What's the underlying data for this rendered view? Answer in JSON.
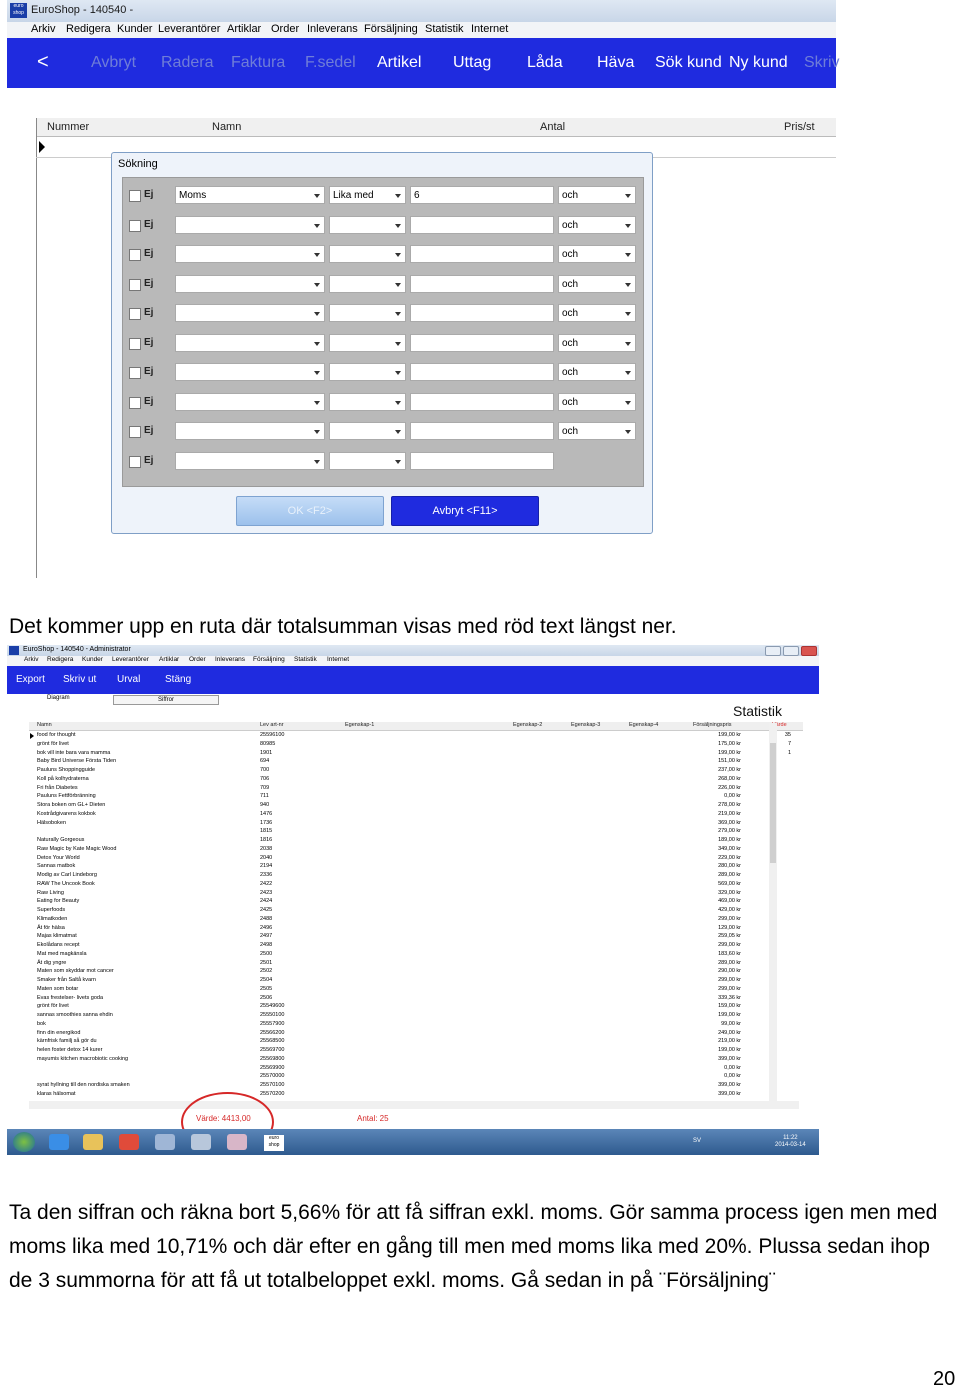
{
  "shot1": {
    "title": "EuroShop - 140540 -",
    "logo_text": "euro shop",
    "menu": [
      "Arkiv",
      "Redigera",
      "Kunder",
      "Leverantörer",
      "Artiklar",
      "Order",
      "Inleverans",
      "Försäljning",
      "Statistik",
      "Internet"
    ],
    "toolbar": {
      "back": "<",
      "items": [
        "Avbryt",
        "Radera",
        "Faktura",
        "F.sedel",
        "Artikel",
        "Uttag",
        "Låda",
        "Häva",
        "Sök kund",
        "Ny kund",
        "Skriv"
      ]
    },
    "grid_headers": {
      "col1": "Nummer",
      "col2": "Namn",
      "col3": "Antal",
      "col4": "Pris/st"
    },
    "dialog": {
      "title": "Sökning",
      "ej_label": "Ej",
      "first_field": "Moms",
      "first_op": "Lika med",
      "first_value": "6",
      "connector": "och",
      "ok_label": "OK <F2>",
      "cancel_label": "Avbryt <F11>"
    }
  },
  "text": {
    "para1": "Det kommer upp en ruta där totalsumman visas med röd text längst ner.",
    "para2": "Ta den siffran och räkna bort 5,66% för att få siffran exkl. moms. Gör samma process igen men med moms lika med 10,71% och där efter en gång till men med moms lika med 20%. Plussa sedan ihop de 3 summorna för att få ut totalbeloppet exkl. moms. Gå sedan in på ¨Försäljning¨",
    "page_number": "20"
  },
  "shot2": {
    "title": "EuroShop - 140540 - Administrator",
    "menu": [
      "Arkiv",
      "Redigera",
      "Kunder",
      "Leverantörer",
      "Artiklar",
      "Order",
      "Inleverans",
      "Försäljning",
      "Statistik",
      "Internet"
    ],
    "toolbar": [
      "Export",
      "Skriv ut",
      "Urval",
      "Stäng"
    ],
    "tabs": {
      "tab1": "Diagram",
      "tab2": "Siffror"
    },
    "heading": "Statistik",
    "headers": {
      "name": "Namn",
      "art": "Lev art-nr",
      "e1": "Egenskap-1",
      "e2": "Egenskap-2",
      "e3": "Egenskap-3",
      "e4": "Egenskap-4",
      "price": "Försäljningspris",
      "value": "Värde"
    },
    "rows": [
      {
        "name": "food for thought",
        "art": "25596100",
        "price": "199,00 kr",
        "value": "35"
      },
      {
        "name": "grönt för livet",
        "art": "80985",
        "price": "175,00 kr",
        "value": "7"
      },
      {
        "name": "bok vill inte bara vara mamma",
        "art": "1901",
        "price": "199,00 kr",
        "value": "1"
      },
      {
        "name": "Baby Bird Universe Första Tiden",
        "art": "694",
        "price": "151,00 kr",
        "value": ""
      },
      {
        "name": "Pauluns Shoppingguide",
        "art": "700",
        "price": "237,00 kr",
        "value": ""
      },
      {
        "name": "Koll på kolhydraterna",
        "art": "706",
        "price": "268,00 kr",
        "value": ""
      },
      {
        "name": "Fri från Diabetes",
        "art": "709",
        "price": "226,00 kr",
        "value": ""
      },
      {
        "name": "Pauluns Fettförbränning",
        "art": "711",
        "price": "0,00 kr",
        "value": ""
      },
      {
        "name": "Stora boken om GL+ Dieten",
        "art": "940",
        "price": "278,00 kr",
        "value": ""
      },
      {
        "name": "Kostrådgivarens kokbok",
        "art": "1476",
        "price": "219,00 kr",
        "value": ""
      },
      {
        "name": "Hälsoboken",
        "art": "1736",
        "price": "369,00 kr",
        "value": ""
      },
      {
        "name": "",
        "art": "1815",
        "price": "279,00 kr",
        "value": ""
      },
      {
        "name": "Naturally Gorgeous",
        "art": "1816",
        "price": "189,00 kr",
        "value": ""
      },
      {
        "name": "Raw Magic by Kate Magic Wood",
        "art": "2038",
        "price": "349,00 kr",
        "value": ""
      },
      {
        "name": "Detox Your World",
        "art": "2040",
        "price": "229,00 kr",
        "value": ""
      },
      {
        "name": "Sannas matbok",
        "art": "2194",
        "price": "280,00 kr",
        "value": ""
      },
      {
        "name": "Modig av Carl Lindeborg",
        "art": "2336",
        "price": "289,00 kr",
        "value": ""
      },
      {
        "name": "RAW The Uncook Book",
        "art": "2422",
        "price": "569,00 kr",
        "value": ""
      },
      {
        "name": "Raw Living",
        "art": "2423",
        "price": "329,00 kr",
        "value": ""
      },
      {
        "name": "Eating for Beauty",
        "art": "2424",
        "price": "469,00 kr",
        "value": ""
      },
      {
        "name": "Superfoods",
        "art": "2425",
        "price": "429,00 kr",
        "value": ""
      },
      {
        "name": "Klimatkoden",
        "art": "2488",
        "price": "299,00 kr",
        "value": ""
      },
      {
        "name": "Ät för hälsa",
        "art": "2496",
        "price": "129,00 kr",
        "value": ""
      },
      {
        "name": "Majas klimatmat",
        "art": "2497",
        "price": "259,05 kr",
        "value": ""
      },
      {
        "name": "Ekolådans recept",
        "art": "2498",
        "price": "299,00 kr",
        "value": ""
      },
      {
        "name": "Mat med magkänsla",
        "art": "2500",
        "price": "183,60 kr",
        "value": ""
      },
      {
        "name": "Ät dig yngre",
        "art": "2501",
        "price": "289,00 kr",
        "value": ""
      },
      {
        "name": "Maten som skyddar mot cancer",
        "art": "2502",
        "price": "290,00 kr",
        "value": ""
      },
      {
        "name": "Smaker från Saltå kvarn",
        "art": "2504",
        "price": "299,00 kr",
        "value": ""
      },
      {
        "name": "Maten som botar",
        "art": "2505",
        "price": "299,00 kr",
        "value": ""
      },
      {
        "name": "Evas frestelser- livets goda",
        "art": "2506",
        "price": "339,36 kr",
        "value": ""
      },
      {
        "name": "grönt för livet",
        "art": "25549600",
        "price": "159,00 kr",
        "value": ""
      },
      {
        "name": "sannas smoothies sanna ehdin",
        "art": "25550100",
        "price": "199,00 kr",
        "value": ""
      },
      {
        "name": "bok",
        "art": "25557900",
        "price": "99,00 kr",
        "value": ""
      },
      {
        "name": "finn din energikod",
        "art": "25566200",
        "price": "249,00 kr",
        "value": ""
      },
      {
        "name": "kärnfrisk familj så gör du",
        "art": "25568500",
        "price": "219,00 kr",
        "value": ""
      },
      {
        "name": "helen foster detox 14 kurer",
        "art": "25569700",
        "price": "199,00 kr",
        "value": ""
      },
      {
        "name": "mayumis kitchen macrobiotic cooking",
        "art": "25569800",
        "price": "399,00 kr",
        "value": ""
      },
      {
        "name": "",
        "art": "25569900",
        "price": "0,00 kr",
        "value": ""
      },
      {
        "name": "",
        "art": "25570000",
        "price": "0,00 kr",
        "value": ""
      },
      {
        "name": "syrat hyllning till den nordiska smaken",
        "art": "25570100",
        "price": "399,00 kr",
        "value": ""
      },
      {
        "name": "klaras hälsomat",
        "art": "25570200",
        "price": "399,00 kr",
        "value": ""
      }
    ],
    "sum_value": "Värde: 4413,00",
    "sum_count": "Antal: 25",
    "taskbar": {
      "lang": "SV",
      "time": "11:22",
      "date": "2014-03-14",
      "logo_text": "euro shop"
    }
  }
}
